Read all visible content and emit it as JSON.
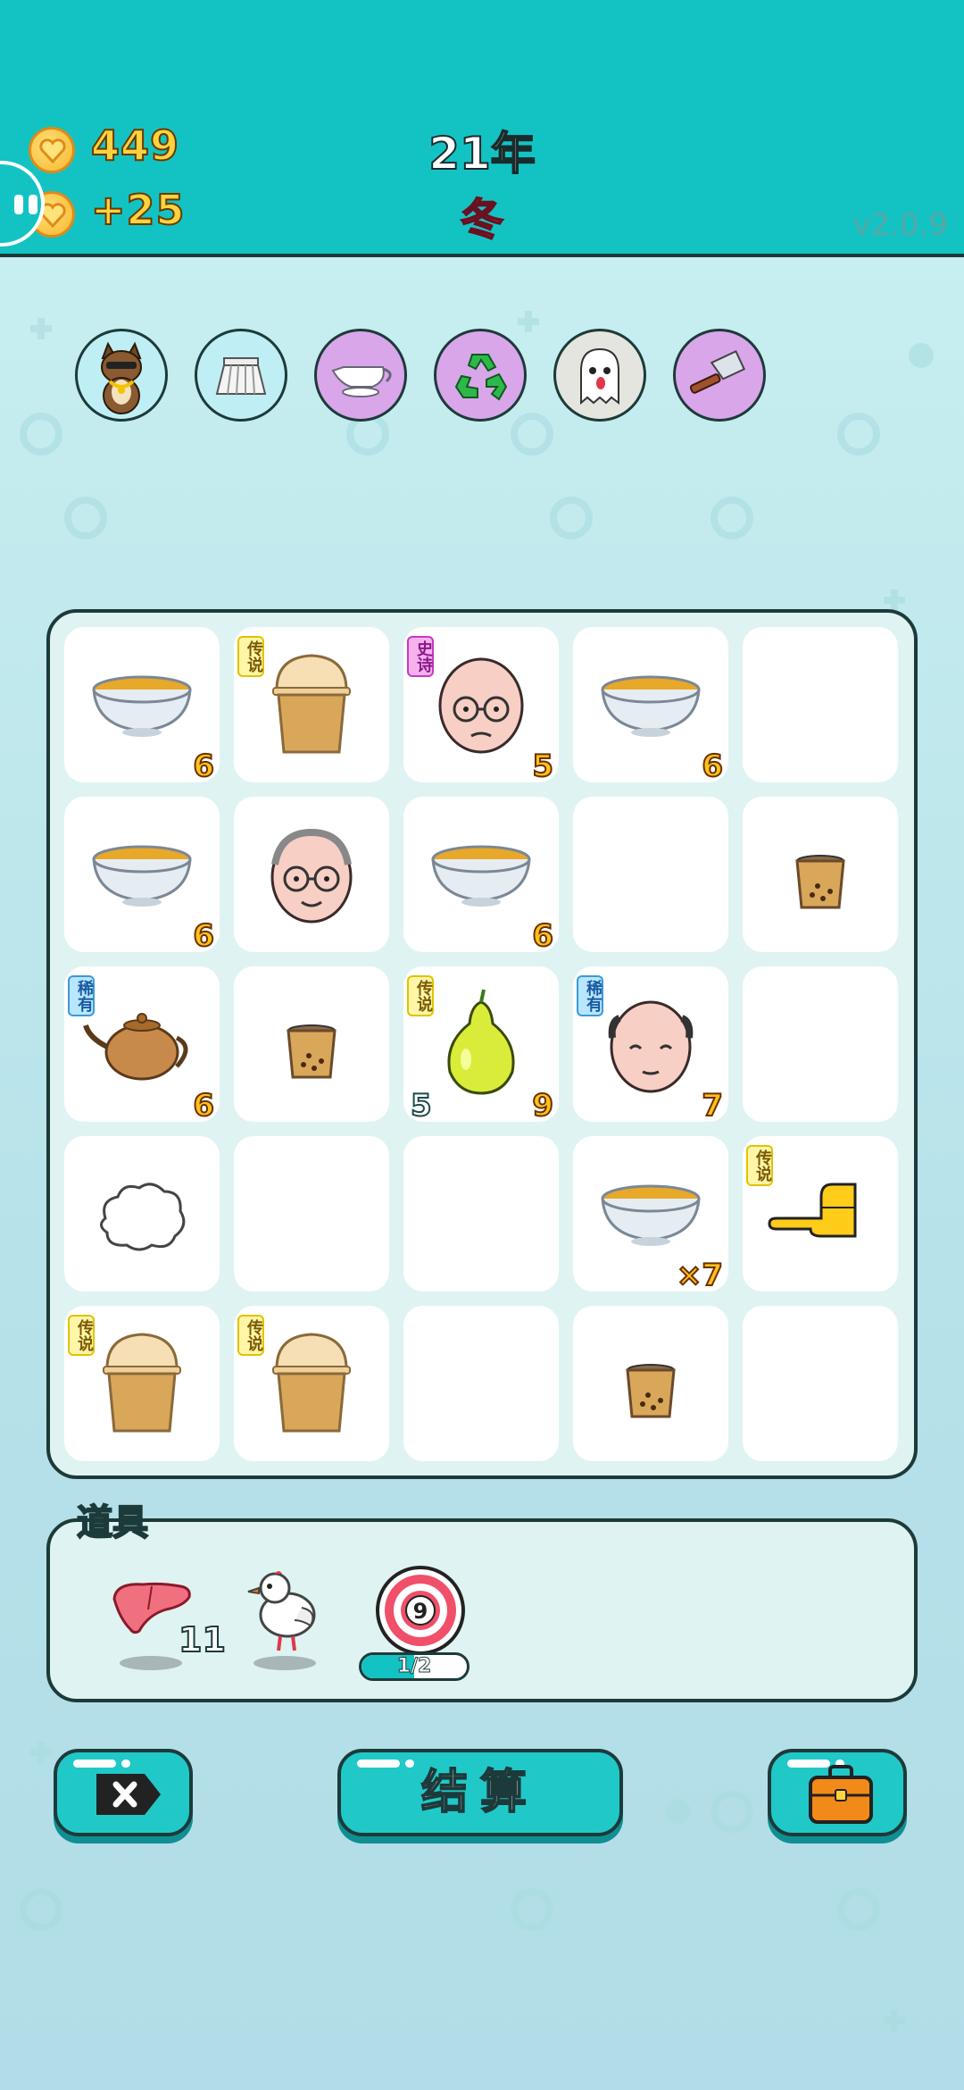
{
  "header": {
    "coins": "449",
    "income": "+25",
    "year": "21年",
    "season": "冬",
    "version": "v2.0.9"
  },
  "relics": [
    "cat-with-gold-chain-icon",
    "pleated-skirt-icon",
    "gravy-boat-icon",
    "recycle-icon",
    "ghost-icon",
    "cleaver-icon"
  ],
  "board": {
    "rows": [
      [
        {
          "item": "soup-bowl",
          "count": "6"
        },
        {
          "item": "bubble-tea-large",
          "badge": "传说"
        },
        {
          "item": "old-man-glasses-bald",
          "badge": "史诗",
          "count": "5"
        },
        {
          "item": "soup-bowl",
          "count": "6"
        },
        {
          "item": "empty"
        }
      ],
      [
        {
          "item": "soup-bowl",
          "count": "6"
        },
        {
          "item": "old-man-glasses"
        },
        {
          "item": "soup-bowl",
          "count": "6"
        },
        {
          "item": "empty"
        },
        {
          "item": "bubble-tea-small"
        }
      ],
      [
        {
          "item": "teapot",
          "badge": "稀有",
          "count": "6"
        },
        {
          "item": "bubble-tea-small"
        },
        {
          "item": "pear",
          "badge": "传说",
          "count_left": "5",
          "count": "9"
        },
        {
          "item": "bald-man",
          "badge": "稀有",
          "count": "7"
        },
        {
          "item": "empty"
        }
      ],
      [
        {
          "item": "cotton"
        },
        {
          "item": "empty"
        },
        {
          "item": "empty"
        },
        {
          "item": "soup-bowl",
          "count": "×7"
        },
        {
          "item": "pointing-hand",
          "badge": "传说"
        }
      ],
      [
        {
          "item": "bubble-tea-large",
          "badge": "传说"
        },
        {
          "item": "bubble-tea-large",
          "badge": "传说"
        },
        {
          "item": "empty"
        },
        {
          "item": "bubble-tea-small"
        },
        {
          "item": "empty"
        }
      ]
    ]
  },
  "props": {
    "title": "道具",
    "items": [
      {
        "icon": "liver-icon",
        "count": "11"
      },
      {
        "icon": "white-bird-icon"
      },
      {
        "icon": "target-icon",
        "value": "9",
        "progress_label": "1/2",
        "progress": 0.5
      }
    ]
  },
  "buttons": {
    "left_icon": "close-tag-icon",
    "settle": "结算",
    "right_icon": "briefcase-icon"
  }
}
